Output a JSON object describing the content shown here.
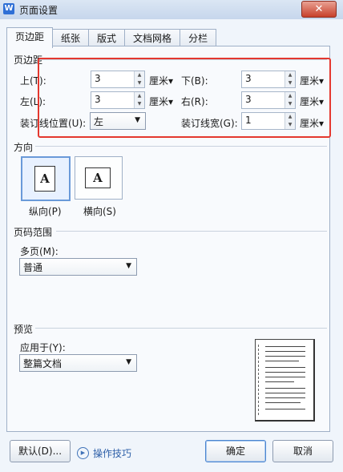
{
  "window": {
    "title": "页面设置",
    "app_icon": "W",
    "close": "✕"
  },
  "tabs": [
    "页边距",
    "纸张",
    "版式",
    "文档网格",
    "分栏"
  ],
  "margins": {
    "section": "页边距",
    "top_label": "上(T):",
    "top_value": "3",
    "bottom_label": "下(B):",
    "bottom_value": "3",
    "left_label": "左(L):",
    "left_value": "3",
    "right_label": "右(R):",
    "right_value": "3",
    "gutter_pos_label": "装订线位置(U):",
    "gutter_pos_value": "左",
    "gutter_label": "装订线宽(G):",
    "gutter_value": "1",
    "unit": "厘米"
  },
  "orientation": {
    "section": "方向",
    "portrait": "纵向(P)",
    "landscape": "横向(S)",
    "icon_letter": "A"
  },
  "pages": {
    "section": "页码范围",
    "multi_label": "多页(M):",
    "multi_value": "普通"
  },
  "preview": {
    "section": "预览",
    "apply_label": "应用于(Y):",
    "apply_value": "整篇文档"
  },
  "buttons": {
    "default": "默认(D)...",
    "tips": "操作技巧",
    "ok": "确定",
    "cancel": "取消"
  },
  "colors": {
    "highlight": "#e4382f",
    "accent": "#2d5fa8"
  }
}
